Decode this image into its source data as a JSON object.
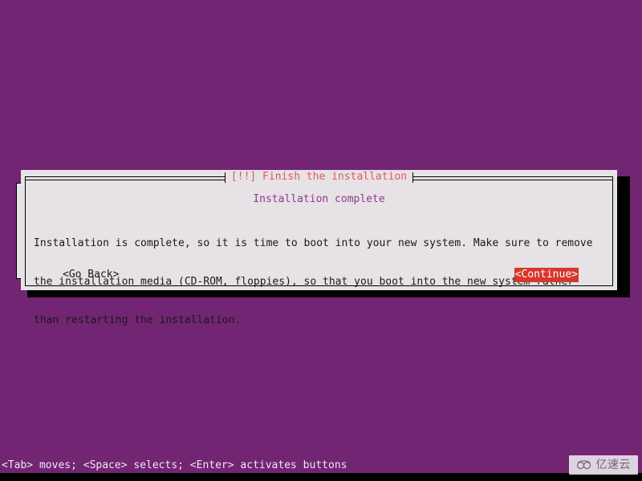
{
  "screen": {
    "background_color": "#722573",
    "text_color": "#f0e8f0"
  },
  "dialog": {
    "title": "[!!] Finish the installation",
    "title_color": "#e05a5a",
    "background_color": "#e6e2e6",
    "heading": "Installation complete",
    "heading_color": "#8d3a8d",
    "paragraph_lines": [
      "Installation is complete, so it is time to boot into your new system. Make sure to remove",
      "the installation media (CD-ROM, floppies), so that you boot into the new system rather",
      "than restarting the installation."
    ],
    "buttons": {
      "go_back": {
        "label": "<Go Back>",
        "selected": false
      },
      "continue": {
        "label": "<Continue>",
        "selected": true,
        "highlight_color": "#d6372c",
        "highlight_text_color": "#ffffff"
      }
    }
  },
  "status_bar": {
    "hint": "<Tab> moves; <Space> selects; <Enter> activates buttons"
  },
  "watermark": {
    "icon": "cloud-icon",
    "text": "亿速云"
  }
}
